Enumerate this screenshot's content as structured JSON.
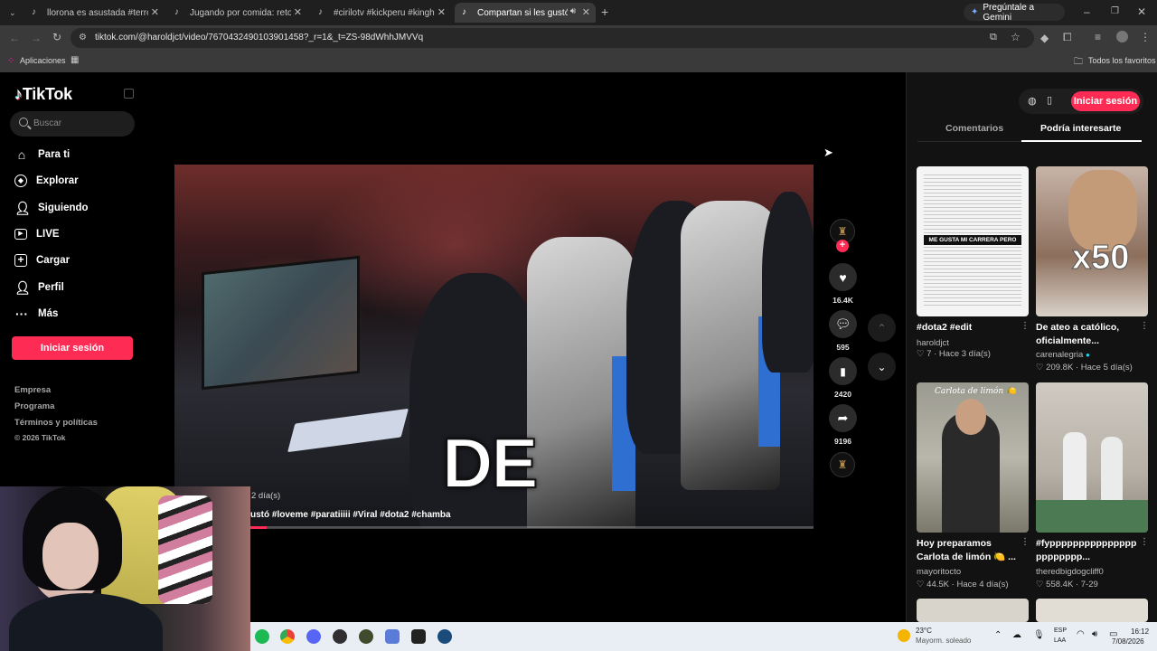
{
  "browser": {
    "tabs": [
      {
        "title": "llorona es asustada #terror #fyp"
      },
      {
        "title": "Jugando por comida: retos y hu"
      },
      {
        "title": "#cirilotv #kickperu #kinghouse"
      },
      {
        "title": "Compartan si les gustó #lo"
      }
    ],
    "gemini_label": "Pregúntale a Gemini",
    "url": "tiktok.com/@haroldjct/video/7670432490103901458?_r=1&_t=ZS-98dWhhJMVVq",
    "bookmarks": {
      "apps": "Aplicaciones",
      "all": "Todos los favoritos"
    }
  },
  "sidebar": {
    "logo": "TikTok",
    "search_placeholder": "Buscar",
    "items": [
      {
        "label": "Para ti",
        "icon": "home-icon"
      },
      {
        "label": "Explorar",
        "icon": "compass-icon"
      },
      {
        "label": "Siguiendo",
        "icon": "following-icon"
      },
      {
        "label": "LIVE",
        "icon": "live-icon"
      },
      {
        "label": "Cargar",
        "icon": "upload-icon"
      },
      {
        "label": "Perfil",
        "icon": "profile-icon"
      },
      {
        "label": "Más",
        "icon": "more-icon"
      }
    ],
    "login_button": "Iniciar sesión",
    "footer": {
      "company": "Empresa",
      "program": "Programa",
      "terms": "Términos y políticas",
      "copyright": "© 2026 TikTok"
    }
  },
  "video": {
    "overlay_word": "DE",
    "age": "2 día(s)",
    "description": "ustó #loveme #paratiiiii #Viral #dota2 #chamba",
    "progress": 0.03,
    "likes": "16.4K",
    "comments": "595",
    "saves": "2420",
    "shares": "9196"
  },
  "right_panel": {
    "login_button": "Iniciar sesión",
    "tabs": [
      {
        "label": "Comentarios",
        "active": false
      },
      {
        "label": "Podría interesarte",
        "active": true
      }
    ],
    "cards": [
      {
        "title": "#dota2 #edit",
        "author": "haroldjct",
        "likes": "7",
        "date": "Hace 3 día(s)",
        "overlay": "ME GUSTA MI CARRERA PERO"
      },
      {
        "title": "De ateo a católico, oficialmente...",
        "author": "carenalegria",
        "likes": "209.8K",
        "date": "Hace 5 día(s)",
        "overlay": "x50"
      },
      {
        "title": "Hoy preparamos Carlota de limón 🍋 ...",
        "author": "mayoritocto",
        "likes": "44.5K",
        "date": "Hace 4 día(s)",
        "overlay": "Carlota de limón 🍋"
      },
      {
        "title": "#fyppppppppppppppppppppppp...",
        "author": "theredbigdogcliff0",
        "likes": "558.4K",
        "date": "7-29",
        "overlay": ""
      }
    ]
  },
  "taskbar": {
    "weather_temp": "23°C",
    "weather_desc": "Mayorm. soleado",
    "lang_top": "ESP",
    "lang_bottom": "LAA",
    "time": "16:12",
    "date": "7/08/2026"
  }
}
